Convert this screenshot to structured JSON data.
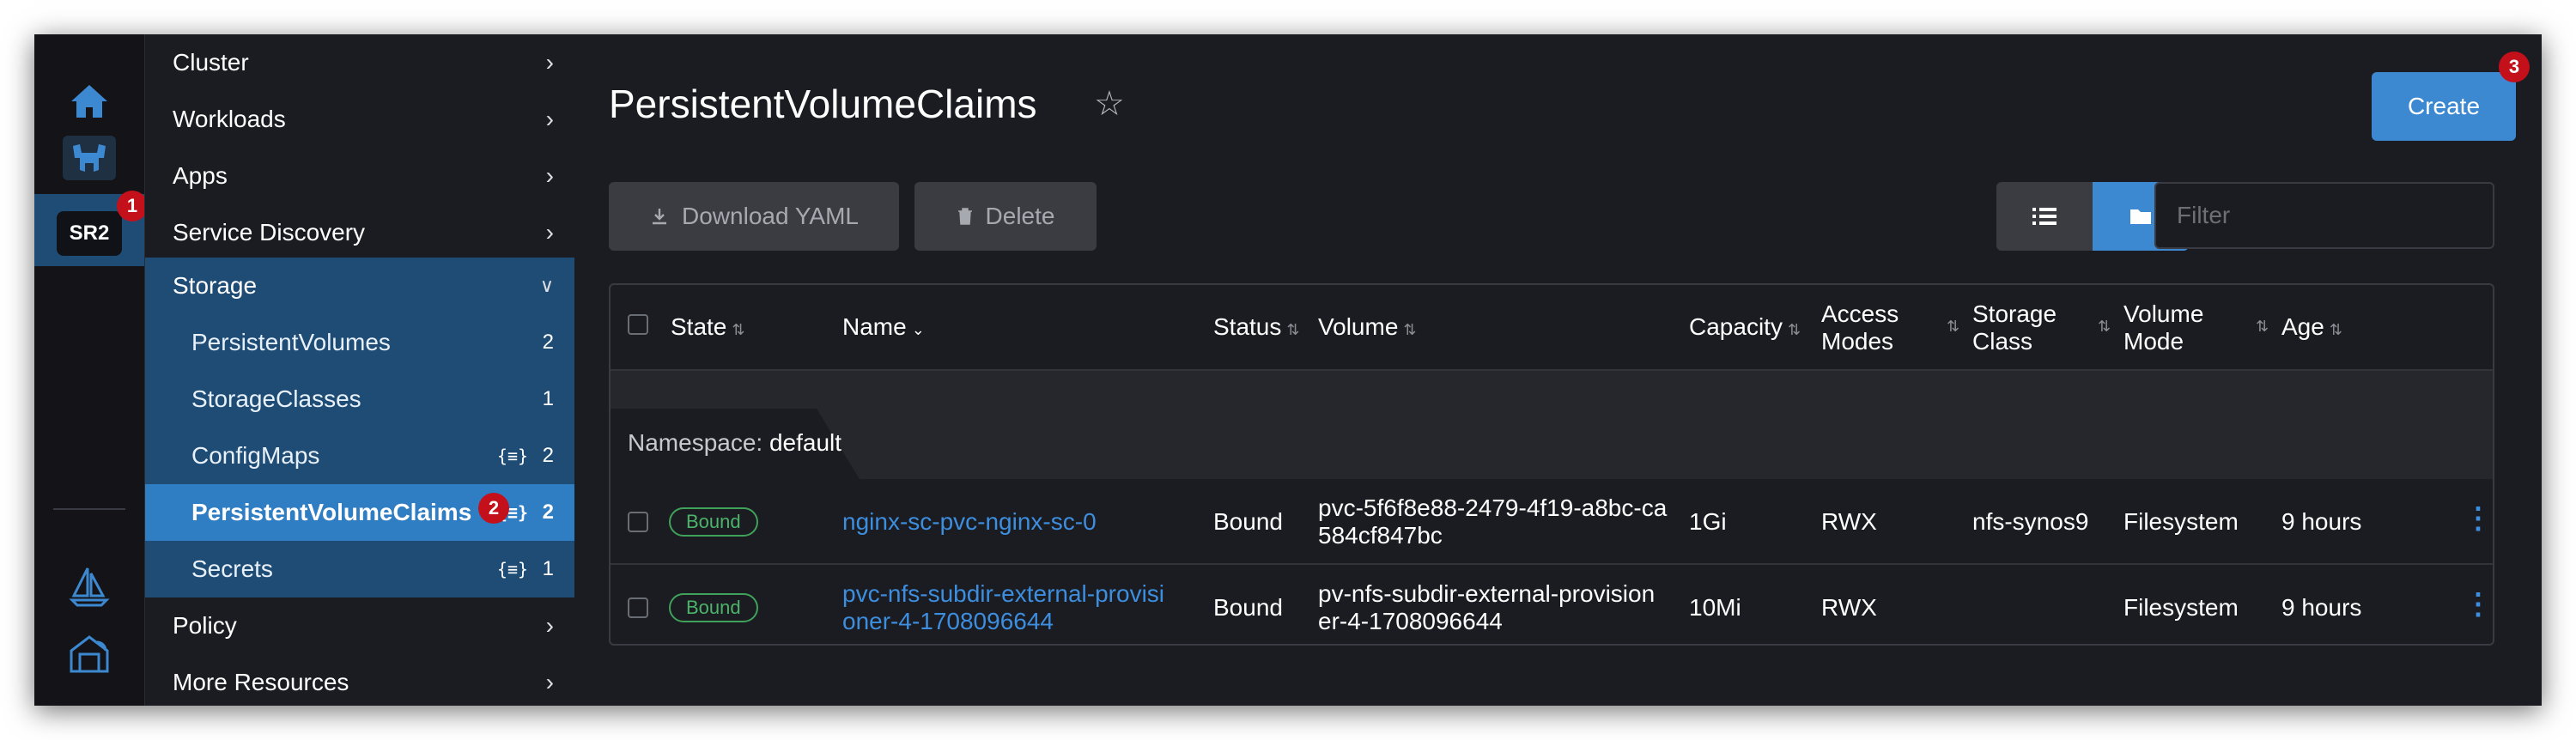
{
  "rail": {
    "home_icon": "home-icon",
    "cluster_icon": "steer-cluster-icon",
    "cluster_badge": "SR2",
    "fleet_icon": "sailboat-icon",
    "extensions_icon": "extensions-icon"
  },
  "callouts": [
    "1",
    "2",
    "3"
  ],
  "nav": {
    "items": [
      {
        "label": "Cluster"
      },
      {
        "label": "Workloads"
      },
      {
        "label": "Apps"
      },
      {
        "label": "Service Discovery"
      },
      {
        "label": "Storage"
      },
      {
        "label": "Policy"
      },
      {
        "label": "More Resources"
      }
    ],
    "storage_sub": [
      {
        "label": "PersistentVolumes",
        "count": "2",
        "namespaced": ""
      },
      {
        "label": "StorageClasses",
        "count": "1",
        "namespaced": ""
      },
      {
        "label": "ConfigMaps",
        "count": "2",
        "namespaced": "{≡}"
      },
      {
        "label": "PersistentVolumeClaims",
        "count": "2",
        "namespaced": "{≡}"
      },
      {
        "label": "Secrets",
        "count": "1",
        "namespaced": "{≡}"
      }
    ]
  },
  "header": {
    "title": "PersistentVolumeClaims",
    "create_label": "Create",
    "download_label": "Download YAML",
    "delete_label": "Delete",
    "filter_placeholder": "Filter"
  },
  "table": {
    "columns": [
      "State",
      "Name",
      "Status",
      "Volume",
      "Capacity",
      "Access Modes",
      "Storage Class",
      "Volume Mode",
      "Age"
    ],
    "namespace_prefix": "Namespace:",
    "namespace": "default",
    "rows": [
      {
        "state": "Bound",
        "name": "nginx-sc-pvc-nginx-sc-0",
        "status": "Bound",
        "volume": "pvc-5f6f8e88-2479-4f19-a8bc-ca584cf847bc",
        "capacity": "1Gi",
        "access": "RWX",
        "storage_class": "nfs-synos9",
        "volume_mode": "Filesystem",
        "age": "9 hours"
      },
      {
        "state": "Bound",
        "name": "pvc-nfs-subdir-external-provisioner-4-1708096644",
        "status": "Bound",
        "volume": "pv-nfs-subdir-external-provisioner-4-1708096644",
        "capacity": "10Mi",
        "access": "RWX",
        "storage_class": "",
        "volume_mode": "Filesystem",
        "age": "9 hours"
      }
    ]
  },
  "colors": {
    "accent": "#3d89d1",
    "active_nav": "#2f7dc3",
    "group_nav": "#1f4c75",
    "bound_green": "#4cb36a",
    "callout_red": "#c3101b"
  }
}
